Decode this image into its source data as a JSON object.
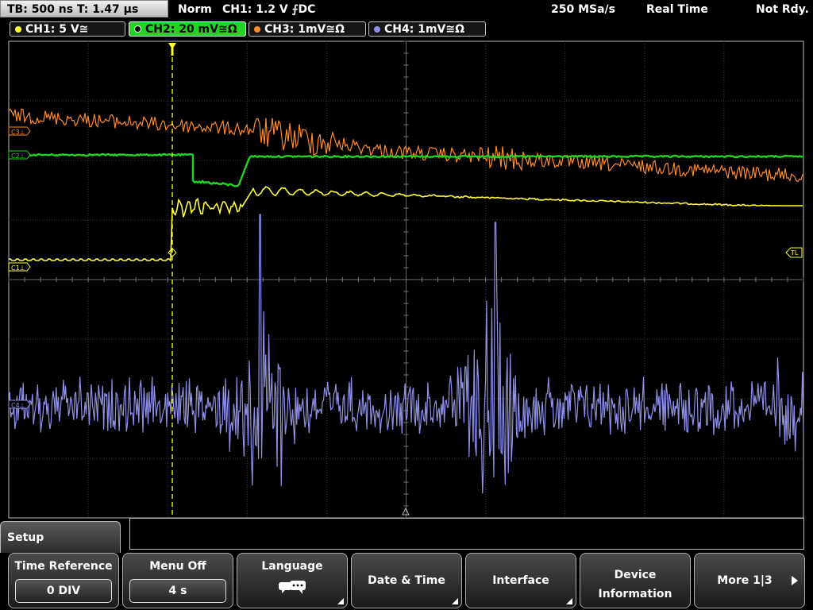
{
  "status": {
    "timebase": "TB: 500 ns   T: 1.47 µs",
    "mode": "Norm",
    "trigger": "CH1: 1.2 V ⨍DC",
    "sample_rate": "250 MSa/s",
    "acq_mode": "Real Time",
    "readiness": "Not Rdy."
  },
  "channels": [
    {
      "label": "CH1: 5 V≅",
      "color": "#ffff33"
    },
    {
      "label": "CH2: 20 mV≅Ω",
      "color": "#22d422"
    },
    {
      "label": "CH3: 1mV≅Ω",
      "color": "#ff8a2a"
    },
    {
      "label": "CH4: 1mV≅Ω",
      "color": "#8f8fe8"
    }
  ],
  "markers": {
    "c3": "C3⊥",
    "c2": "C2⊥",
    "c1": "C1⊥",
    "c4": "C4⊥",
    "tl": "TL"
  },
  "menu": {
    "title": "Setup",
    "softkeys": [
      {
        "label": "Time Reference",
        "value": "0 DIV"
      },
      {
        "label": "Menu Off",
        "value": "4 s"
      },
      {
        "label": "Language",
        "icon": "speech-bubbles-icon"
      },
      {
        "label": "Date & Time"
      },
      {
        "label": "Interface"
      },
      {
        "label": "Device Information"
      },
      {
        "label": "More 1|3",
        "icon": "arrow-right-icon"
      }
    ]
  }
}
